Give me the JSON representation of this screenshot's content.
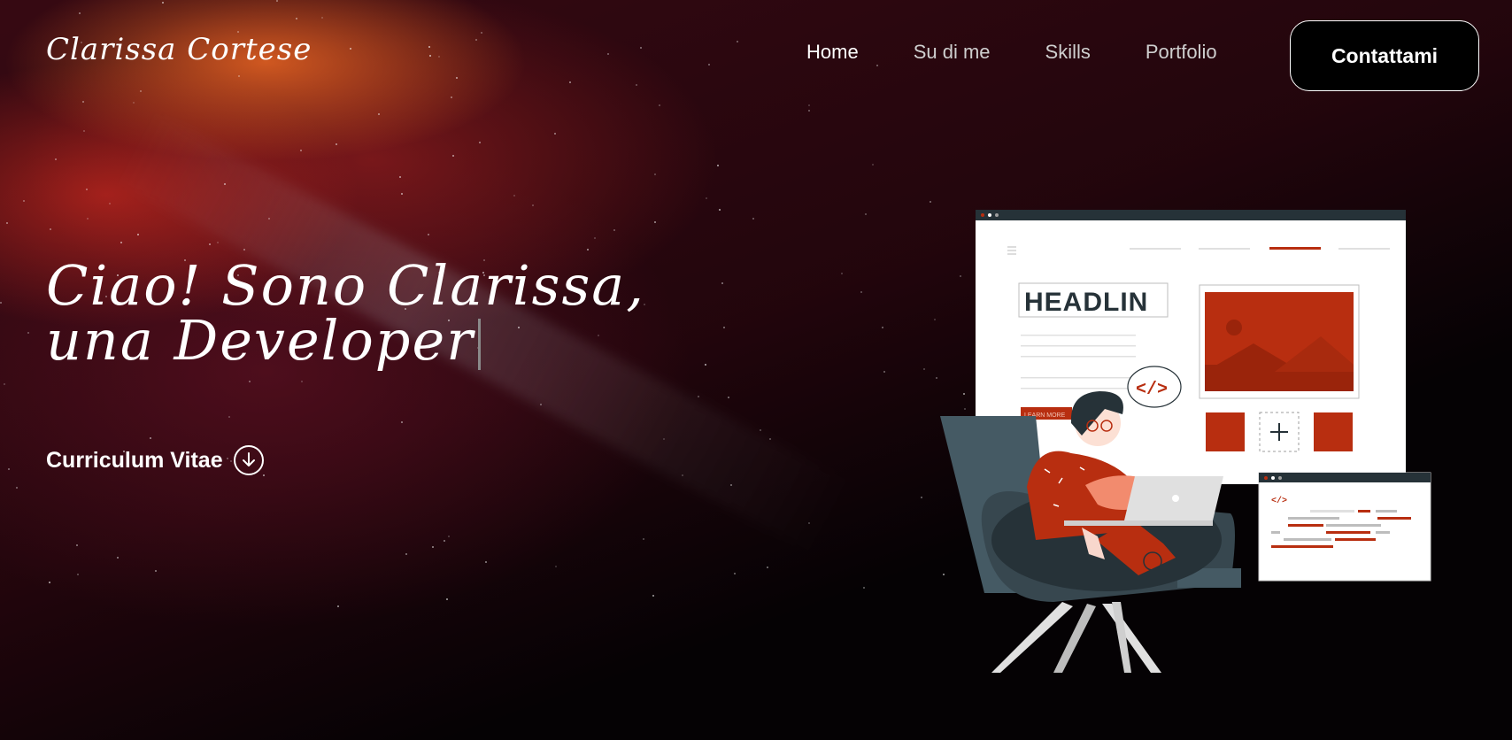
{
  "brand": {
    "name": "Clarissa Cortese"
  },
  "nav": {
    "items": [
      {
        "label": "Home",
        "active": true
      },
      {
        "label": "Su di me",
        "active": false
      },
      {
        "label": "Skills",
        "active": false
      },
      {
        "label": "Portfolio",
        "active": false
      }
    ],
    "cta_label": "Contattami"
  },
  "hero": {
    "headline": "Ciao! Sono Clarissa, una Developer",
    "cv_label": "Curriculum Vitae",
    "cv_icon": "arrow-down-circle-icon"
  },
  "illustration": {
    "headline_text": "HEADLIN",
    "button_text": "LEARN MORE",
    "code_symbol": "</>"
  },
  "colors": {
    "accent": "#b82e10",
    "background": "#050204",
    "text": "#ffffff"
  }
}
